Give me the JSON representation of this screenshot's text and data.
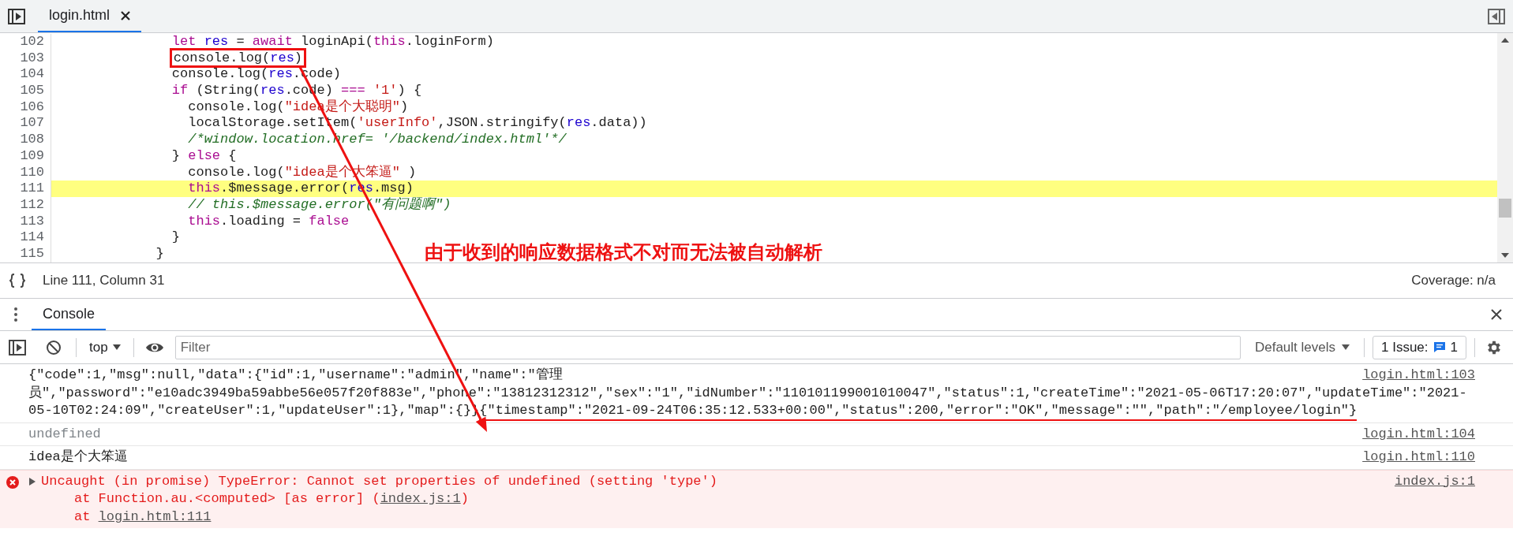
{
  "tab_bar": {
    "tabs": [
      {
        "label": "login.html",
        "selected": true
      }
    ]
  },
  "editor": {
    "lines": [
      {
        "number": "102",
        "highlighted": false,
        "boxed": false,
        "tokens": [
          {
            "kind": "kw",
            "t": "              let"
          },
          {
            "kind": "var",
            "t": " res"
          },
          {
            "kind": "plain",
            "t": " = "
          },
          {
            "kind": "kw",
            "t": "await"
          },
          {
            "kind": "plain",
            "t": " loginApi("
          },
          {
            "kind": "kw",
            "t": "this"
          },
          {
            "kind": "plain",
            "t": ".loginForm)"
          }
        ]
      },
      {
        "number": "103",
        "highlighted": false,
        "boxed": true,
        "tokens": [
          {
            "kind": "plain",
            "t": "              console.log("
          },
          {
            "kind": "var",
            "t": "res"
          },
          {
            "kind": "plain",
            "t": ")"
          }
        ]
      },
      {
        "number": "104",
        "highlighted": false,
        "boxed": false,
        "tokens": [
          {
            "kind": "plain",
            "t": "              console.log("
          },
          {
            "kind": "var",
            "t": "res"
          },
          {
            "kind": "plain",
            "t": ".code)"
          }
        ]
      },
      {
        "number": "105",
        "highlighted": false,
        "boxed": false,
        "tokens": [
          {
            "kind": "kw",
            "t": "              if"
          },
          {
            "kind": "plain",
            "t": " (String("
          },
          {
            "kind": "var",
            "t": "res"
          },
          {
            "kind": "plain",
            "t": ".code) "
          },
          {
            "kind": "kw",
            "t": "==="
          },
          {
            "kind": "str",
            "t": " '1'"
          },
          {
            "kind": "plain",
            "t": ") {"
          }
        ]
      },
      {
        "number": "106",
        "highlighted": false,
        "boxed": false,
        "tokens": [
          {
            "kind": "plain",
            "t": "                console.log("
          },
          {
            "kind": "str",
            "t": "\"idea是个大聪明\""
          },
          {
            "kind": "plain",
            "t": ")"
          }
        ]
      },
      {
        "number": "107",
        "highlighted": false,
        "boxed": false,
        "tokens": [
          {
            "kind": "plain",
            "t": "                localStorage.setItem("
          },
          {
            "kind": "str",
            "t": "'userInfo'"
          },
          {
            "kind": "plain",
            "t": ",JSON.stringify("
          },
          {
            "kind": "var",
            "t": "res"
          },
          {
            "kind": "plain",
            "t": ".data))"
          }
        ]
      },
      {
        "number": "108",
        "highlighted": false,
        "boxed": false,
        "tokens": [
          {
            "kind": "comment",
            "t": "                /*window.location.href= '/backend/index.html'*/"
          }
        ]
      },
      {
        "number": "109",
        "highlighted": false,
        "boxed": false,
        "tokens": [
          {
            "kind": "plain",
            "t": "              } "
          },
          {
            "kind": "kw",
            "t": "else"
          },
          {
            "kind": "plain",
            "t": " {"
          }
        ]
      },
      {
        "number": "110",
        "highlighted": false,
        "boxed": false,
        "tokens": [
          {
            "kind": "plain",
            "t": "                console.log("
          },
          {
            "kind": "str",
            "t": "\"idea是个大笨逼\""
          },
          {
            "kind": "plain",
            "t": " )"
          }
        ]
      },
      {
        "number": "111",
        "highlighted": true,
        "boxed": false,
        "tokens": [
          {
            "kind": "kw",
            "t": "                this"
          },
          {
            "kind": "plain",
            "t": ".$message.error("
          },
          {
            "kind": "var",
            "t": "res"
          },
          {
            "kind": "plain",
            "t": ".msg)"
          }
        ]
      },
      {
        "number": "112",
        "highlighted": false,
        "boxed": false,
        "tokens": [
          {
            "kind": "comment",
            "t": "                // this.$message.error(\"有问题啊\")"
          }
        ]
      },
      {
        "number": "113",
        "highlighted": false,
        "boxed": false,
        "tokens": [
          {
            "kind": "kw",
            "t": "                this"
          },
          {
            "kind": "plain",
            "t": ".loading = "
          },
          {
            "kind": "kw",
            "t": "false"
          }
        ]
      },
      {
        "number": "114",
        "highlighted": false,
        "boxed": false,
        "tokens": [
          {
            "kind": "plain",
            "t": "              }"
          }
        ]
      },
      {
        "number": "115",
        "highlighted": false,
        "boxed": false,
        "tokens": [
          {
            "kind": "plain",
            "t": "            }"
          }
        ]
      }
    ]
  },
  "status_bar": {
    "cursor": "Line 111, Column 31",
    "coverage": "Coverage: n/a"
  },
  "drawer": {
    "tabs": [
      {
        "label": "Console",
        "selected": true
      }
    ]
  },
  "console_toolbar": {
    "context": "top",
    "filter": {
      "placeholder": "Filter"
    },
    "levels": "Default levels",
    "issues": {
      "label": "1 Issue:",
      "count": "1"
    }
  },
  "messages": [
    {
      "kind": "log",
      "text": "{\"code\":1,\"msg\":null,\"data\":{\"id\":1,\"username\":\"admin\",\"name\":\"管理员\",\"password\":\"e10adc3949ba59abbe56e057f20f883e\",\"phone\":\"13812312312\",\"sex\":\"1\",\"idNumber\":\"110101199001010047\",\"status\":1,\"createTime\":\"2021-05-06T17:20:07\",\"updateTime\":\"2021-05-10T02:24:09\",\"createUser\":1,\"updateUser\":1},\"map\":{}}",
      "underlined_text": "{\"timestamp\":\"2021-09-24T06:35:12.533+00:00\",\"status\":200,\"error\":\"OK\",\"message\":\"\",\"path\":\"/employee/login\"}",
      "source": "login.html:103"
    },
    {
      "kind": "muted",
      "text": "undefined",
      "source": "login.html:104"
    },
    {
      "kind": "log",
      "text": "idea是个大笨逼",
      "source": "login.html:110"
    },
    {
      "kind": "error",
      "expanded": false,
      "text": "Uncaught (in promise) TypeError: Cannot set properties of undefined (setting 'type')",
      "source": "index.js:1",
      "stack": [
        {
          "text": "at Function.au.<computed> [as error] (",
          "link": "index.js:1",
          "after": ")"
        },
        {
          "text": "at ",
          "link": "login.html:111"
        }
      ]
    }
  ],
  "annotation": {
    "note": "由于收到的响应数据格式不对而无法被自动解析"
  }
}
